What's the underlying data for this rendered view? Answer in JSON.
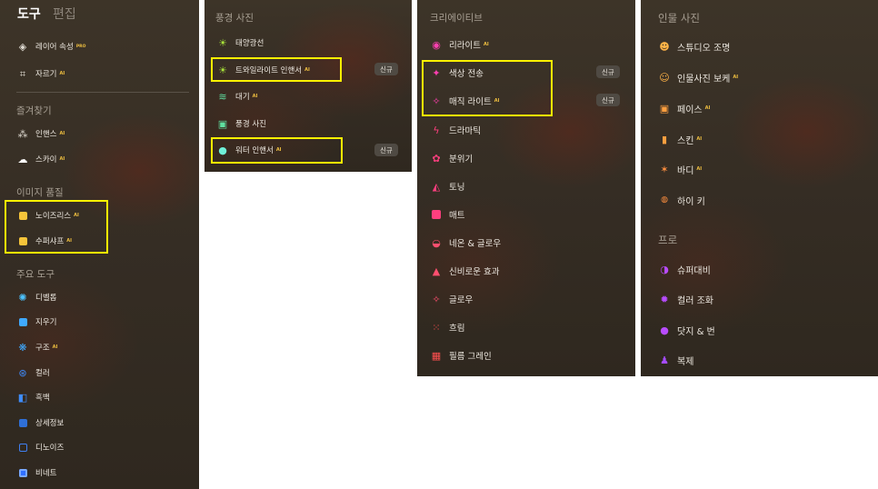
{
  "panel1": {
    "tabs": {
      "tools": "도구",
      "edit": "편집"
    },
    "top_items": [
      {
        "label": "레이어 속성",
        "tag": "PRO"
      },
      {
        "label": "자르기",
        "tag": "AI"
      }
    ],
    "favorites": {
      "title": "즐겨찾기",
      "items": [
        {
          "label": "인핸스",
          "tag": "AI"
        },
        {
          "label": "스카이",
          "tag": "AI"
        }
      ]
    },
    "quality": {
      "title": "이미지 품질",
      "items": [
        {
          "label": "노이즈리스",
          "tag": "AI"
        },
        {
          "label": "수퍼샤프",
          "tag": "AI"
        }
      ]
    },
    "main_tools": {
      "title": "주요 도구",
      "items": [
        {
          "label": "디벨롭",
          "tag": ""
        },
        {
          "label": "지우기",
          "tag": ""
        },
        {
          "label": "구조",
          "tag": "AI"
        },
        {
          "label": "컬러",
          "tag": ""
        },
        {
          "label": "흑백",
          "tag": ""
        },
        {
          "label": "상세정보",
          "tag": ""
        },
        {
          "label": "디노이즈",
          "tag": ""
        },
        {
          "label": "비네트",
          "tag": ""
        }
      ]
    }
  },
  "panel2": {
    "title": "풍경 사진",
    "items": [
      {
        "label": "태양광선",
        "tag": "",
        "badge": ""
      },
      {
        "label": "트와일라이트 인핸서",
        "tag": "AI",
        "badge": "신규"
      },
      {
        "label": "대기",
        "tag": "AI",
        "badge": ""
      },
      {
        "label": "풍경 사진",
        "tag": "",
        "badge": ""
      },
      {
        "label": "워터 인핸서",
        "tag": "AI",
        "badge": "신규"
      }
    ]
  },
  "panel3": {
    "title": "크리에이티브",
    "items": [
      {
        "label": "리라이트",
        "tag": "AI",
        "badge": ""
      },
      {
        "label": "색상 전송",
        "tag": "",
        "badge": "신규"
      },
      {
        "label": "매직 라이트",
        "tag": "AI",
        "badge": "신규"
      },
      {
        "label": "드라마틱",
        "tag": "",
        "badge": ""
      },
      {
        "label": "분위기",
        "tag": "",
        "badge": ""
      },
      {
        "label": "토닝",
        "tag": "",
        "badge": ""
      },
      {
        "label": "매트",
        "tag": "",
        "badge": ""
      },
      {
        "label": "네온 & 글로우",
        "tag": "",
        "badge": ""
      },
      {
        "label": "신비로운 효과",
        "tag": "",
        "badge": ""
      },
      {
        "label": "글로우",
        "tag": "",
        "badge": ""
      },
      {
        "label": "흐림",
        "tag": "",
        "badge": ""
      },
      {
        "label": "필름 그레인",
        "tag": "",
        "badge": ""
      }
    ]
  },
  "panel4": {
    "title": "인물 사진",
    "items": [
      {
        "label": "스튜디오 조명",
        "tag": ""
      },
      {
        "label": "인물사진 보케",
        "tag": "AI"
      },
      {
        "label": "페이스",
        "tag": "AI"
      },
      {
        "label": "스킨",
        "tag": "AI"
      },
      {
        "label": "바디",
        "tag": "AI"
      },
      {
        "label": "하이 키",
        "tag": ""
      }
    ],
    "pro": {
      "title": "프로",
      "items": [
        {
          "label": "슈퍼대비"
        },
        {
          "label": "컬러 조화"
        },
        {
          "label": "닷지 & 번"
        },
        {
          "label": "복제"
        }
      ]
    }
  },
  "colors": {
    "highlight": "#fff200",
    "ai_tag": "#f0c040",
    "badge_bg": "#4f4a43"
  }
}
